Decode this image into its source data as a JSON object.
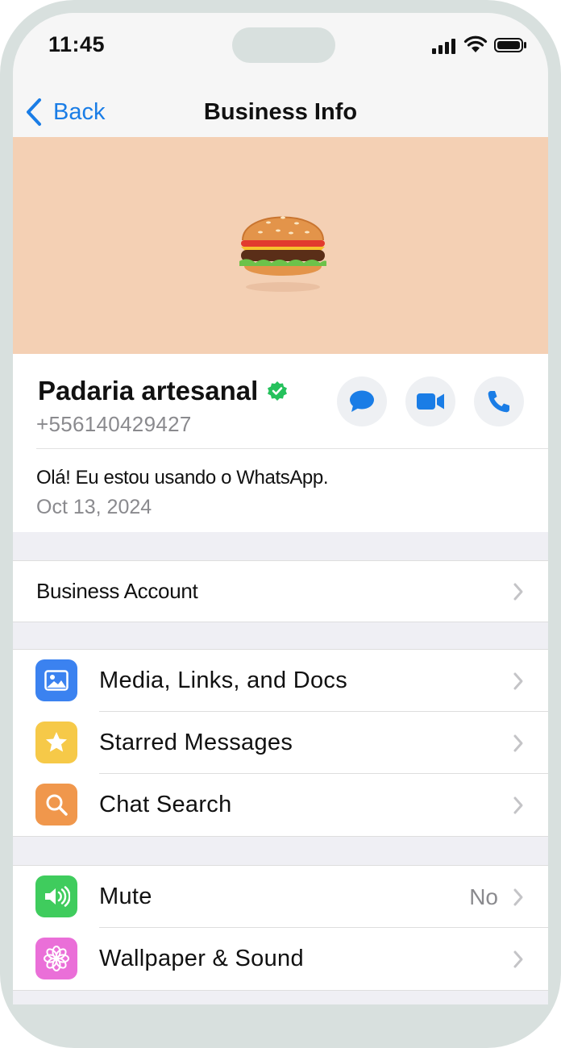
{
  "status_bar": {
    "time": "11:45"
  },
  "nav": {
    "back_label": "Back",
    "title": "Business Info"
  },
  "cover": {
    "emoji": "burger",
    "background": "#f4d0b4"
  },
  "business": {
    "name": "Padaria artesanal",
    "verified": true,
    "phone": "+556140429427",
    "about": "Olá! Eu estou usando o WhatsApp.",
    "about_date": "Oct 13, 2024",
    "actions": [
      "message",
      "video-call",
      "voice-call"
    ]
  },
  "business_account": {
    "label": "Business Account"
  },
  "menu_group_1": [
    {
      "label": "Media, Links, and Docs",
      "icon": "photo-icon",
      "color": "#3b82f0"
    },
    {
      "label": "Starred Messages",
      "icon": "star-icon",
      "color": "#f6c948"
    },
    {
      "label": "Chat Search",
      "icon": "search-icon",
      "color": "#f0974c"
    }
  ],
  "menu_group_2": [
    {
      "label": "Mute",
      "value": "No",
      "icon": "speaker-icon",
      "color": "#3fcc5d"
    },
    {
      "label": "Wallpaper & Sound",
      "icon": "flower-icon",
      "color": "#ea6fd8"
    }
  ],
  "colors": {
    "accent": "#1a7de6",
    "verified": "#25c15c"
  }
}
